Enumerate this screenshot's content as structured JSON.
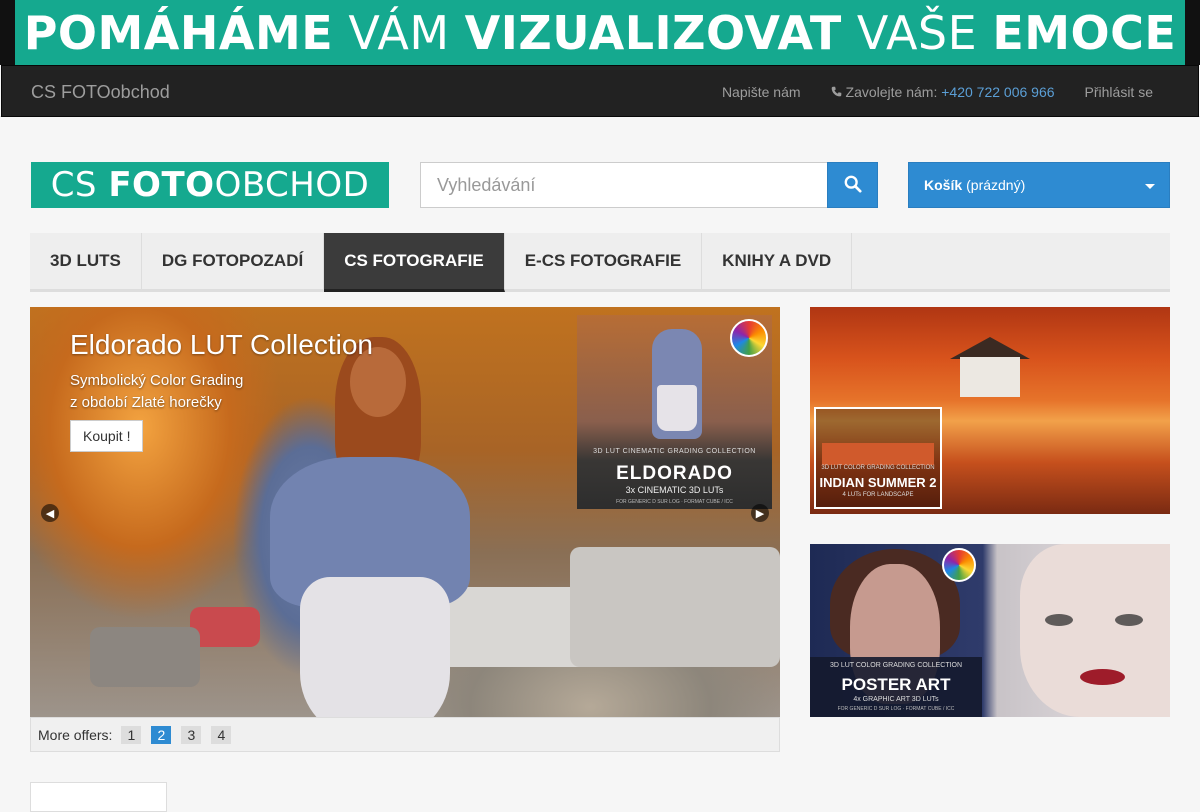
{
  "banner": {
    "word1": "POMÁHÁME",
    "word2": "VÁM",
    "word3": "VIZUALIZOVAT",
    "word4": "VAŠE",
    "word5": "EMOCE",
    "bg_color": "#15a98f"
  },
  "topnav": {
    "brand": "CS FOTOobchod",
    "contact_label": "Napište nám",
    "phone_icon": "phone-icon",
    "phone_label": "Zavolejte nám:",
    "phone_number": "+420 722 006 966",
    "login_label": "Přihlásit se"
  },
  "header": {
    "logo_cs": "CS",
    "logo_foto": "FOTO",
    "logo_obchod": "OBCHOD",
    "search_placeholder": "Vyhledávání",
    "search_icon": "search-icon",
    "cart_label": "Košík",
    "cart_status": "(prázdný)",
    "accent_color": "#2e8bd2"
  },
  "categories": [
    {
      "label": "3D LUTs",
      "active": false
    },
    {
      "label": "DG fotopozadí",
      "active": false
    },
    {
      "label": "CS Fotografie",
      "active": true
    },
    {
      "label": "E-CS Fotografie",
      "active": false
    },
    {
      "label": "Knihy a DVD",
      "active": false
    }
  ],
  "carousel": {
    "title": "Eldorado LUT Collection",
    "subtitle_line1": "Symbolický Color Grading",
    "subtitle_line2": "z období Zlaté horečky",
    "button": "Koupit !",
    "product_line1": "3D LUT CINEMATIC GRADING COLLECTION",
    "product_name": "ELDORADO",
    "product_line3": "3x CINEMATIC 3D LUTs",
    "product_line4": "FOR GENERIC D SUR LOG · FORMAT CUBE / ICC",
    "prev_symbol": "◀",
    "next_symbol": "▶"
  },
  "pager": {
    "label": "More offers:",
    "pages": [
      "1",
      "2",
      "3",
      "4"
    ],
    "active_page": "2"
  },
  "side_banners": {
    "one": {
      "line1": "3D LUT COLOR GRADING COLLECTION",
      "name": "INDIAN SUMMER 2",
      "line3": "4 LUTs FOR LANDSCAPE",
      "line4": "FOR GENERIC D SUR LOG · FORMAT CUBE / ICC"
    },
    "two": {
      "line1": "3D LUT COLOR GRADING COLLECTION",
      "name": "POSTER ART",
      "line3": "4x GRAPHIC ART 3D LUTs",
      "line4": "FOR GENERIC D SUR LOG · FORMAT CUBE / ICC"
    }
  }
}
